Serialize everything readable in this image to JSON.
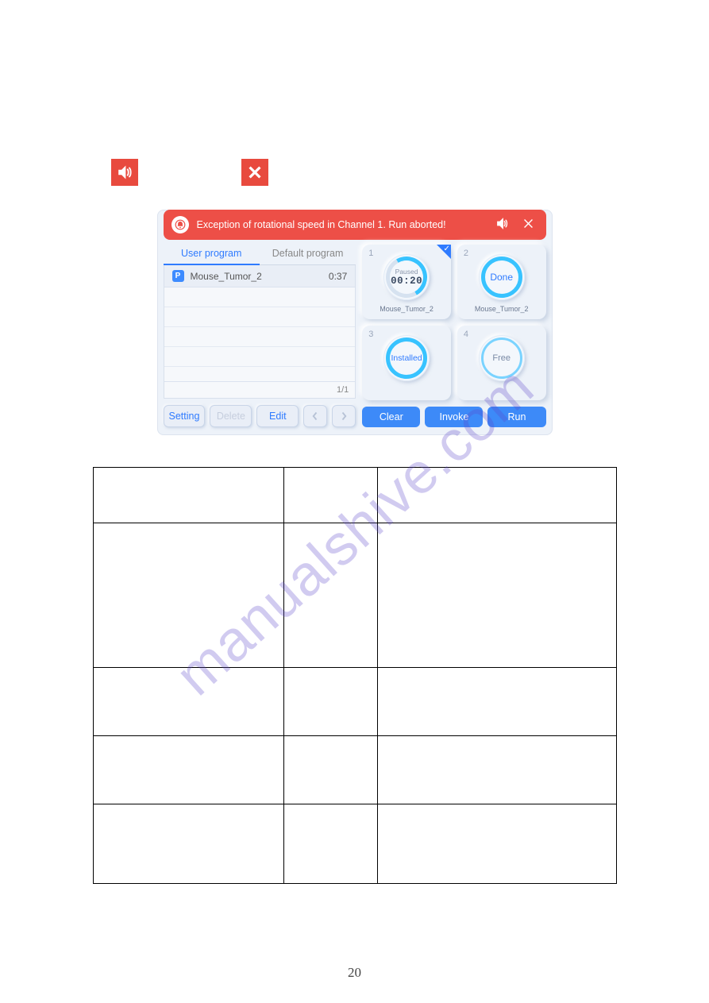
{
  "watermark": "manualshive.com",
  "page_number": "20",
  "alert": {
    "message": "Exception of rotational speed in Channel 1. Run aborted!"
  },
  "tabs": {
    "user": "User program",
    "default": "Default program"
  },
  "program_list": {
    "badge": "P",
    "name": "Mouse_Tumor_2",
    "time": "0:37",
    "pager": "1/1"
  },
  "left_buttons": {
    "setting": "Setting",
    "delete": "Delete",
    "edit": "Edit"
  },
  "channels": {
    "c1": {
      "num": "1",
      "status": "Paused",
      "time": "00:20",
      "label": "Mouse_Tumor_2"
    },
    "c2": {
      "num": "2",
      "status": "Done",
      "label": "Mouse_Tumor_2"
    },
    "c3": {
      "num": "3",
      "status": "Installed"
    },
    "c4": {
      "num": "4",
      "status": "Free"
    }
  },
  "right_buttons": {
    "clear": "Clear",
    "invoke": "Invoke",
    "run": "Run"
  }
}
